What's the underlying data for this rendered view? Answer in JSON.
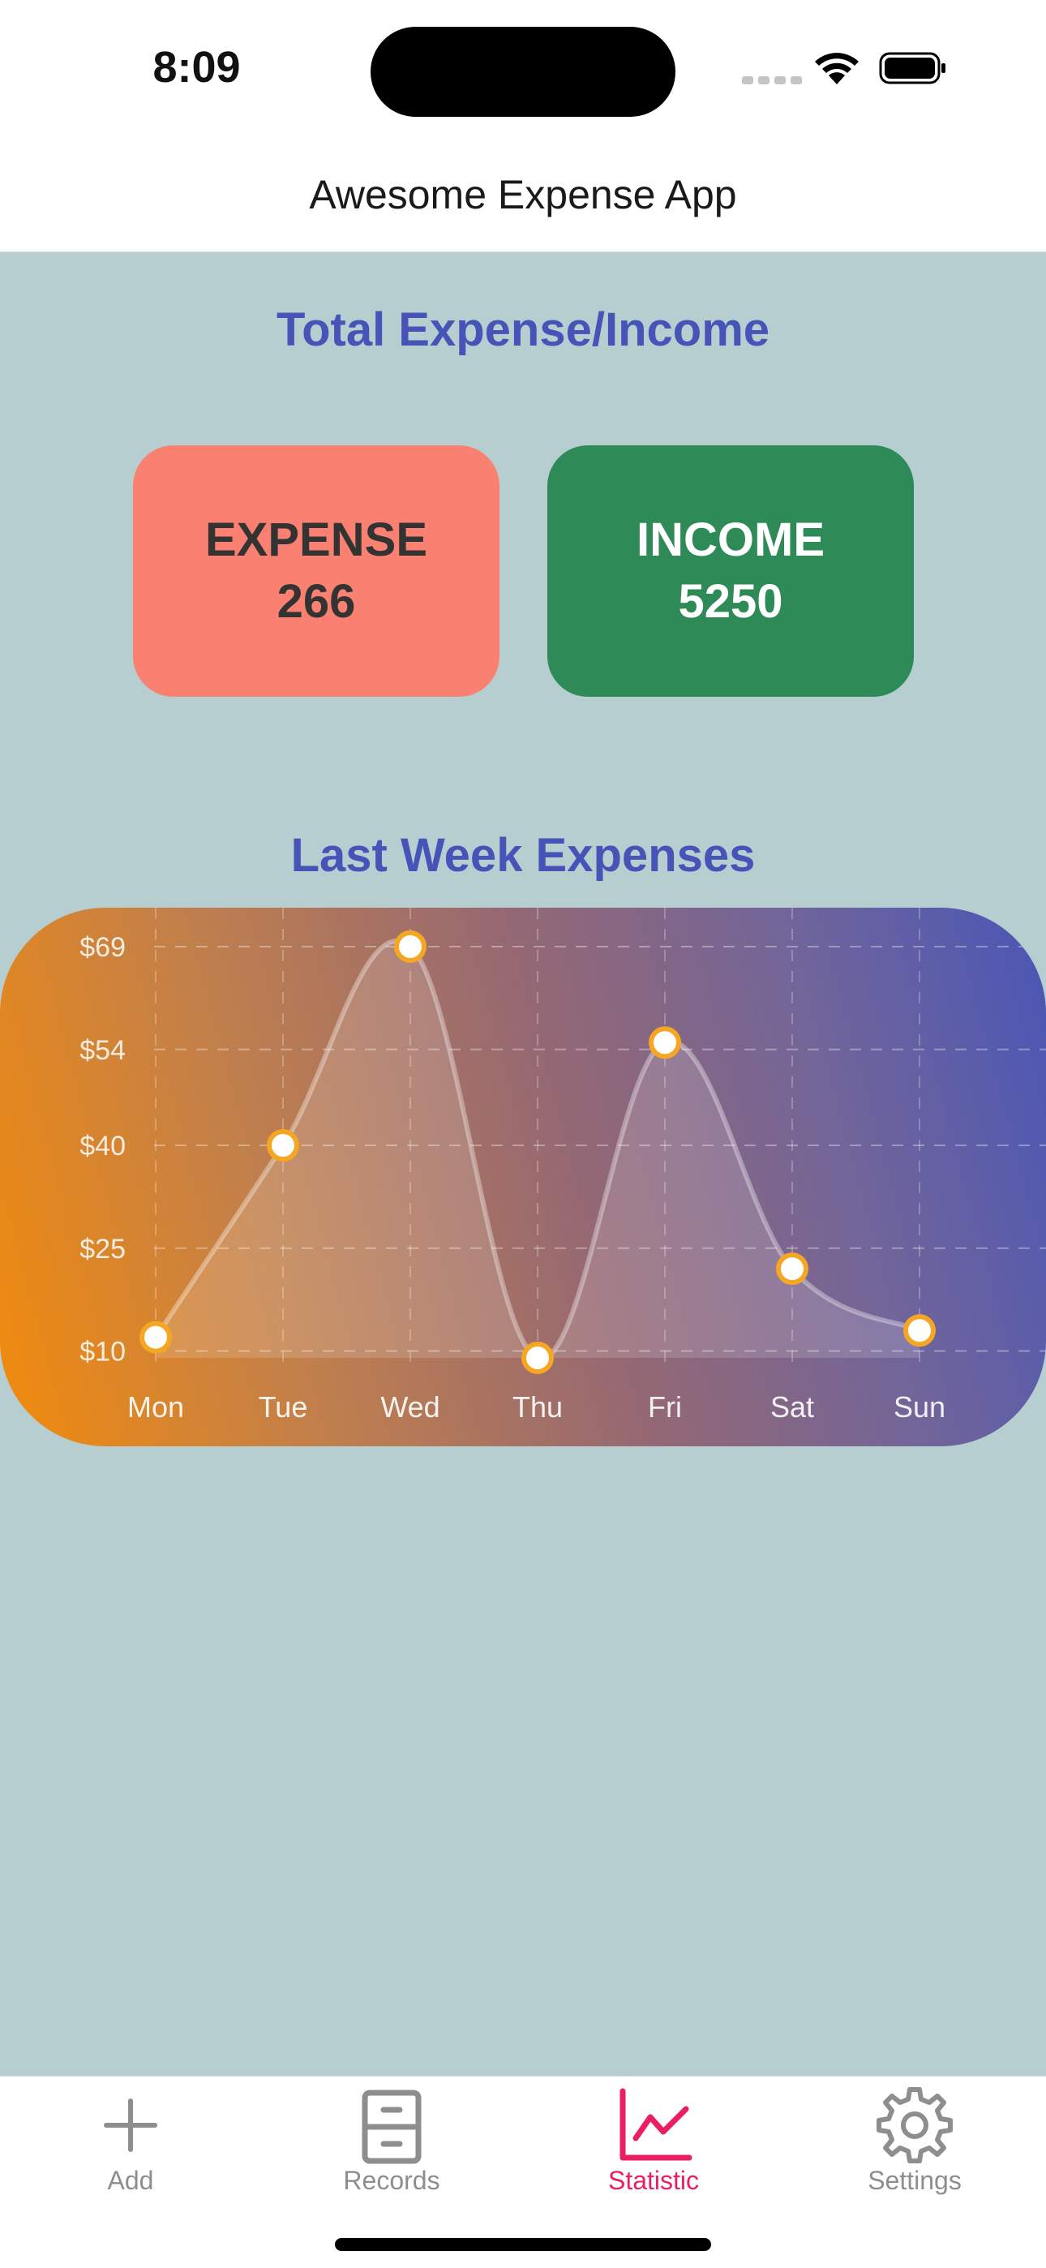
{
  "status_bar": {
    "time": "8:09",
    "icons": [
      "cellular-signal-icon",
      "wifi-icon",
      "battery-icon"
    ]
  },
  "nav": {
    "title": "Awesome Expense App"
  },
  "summary": {
    "title": "Total Expense/Income",
    "expense": {
      "label": "EXPENSE",
      "value": "266",
      "color": "#fa8072"
    },
    "income": {
      "label": "INCOME",
      "value": "5250",
      "color": "#2e8b57"
    }
  },
  "weekly": {
    "title": "Last Week Expenses"
  },
  "chart_data": {
    "type": "line",
    "categories": [
      "Mon",
      "Tue",
      "Wed",
      "Thu",
      "Fri",
      "Sat",
      "Sun"
    ],
    "series": [
      {
        "values": [
          12,
          40,
          69,
          9,
          55,
          22,
          13
        ]
      }
    ],
    "y_ticks": [
      10,
      25,
      40,
      54,
      69
    ],
    "y_tick_labels": [
      "$10",
      "$25",
      "$40",
      "$54",
      "$69"
    ],
    "ylim": [
      9,
      69
    ],
    "grid": true,
    "colors": {
      "line": "#ffffff",
      "point_fill": "#ffffff",
      "point_stroke": "#f5a623"
    }
  },
  "tab_bar": {
    "tabs": [
      {
        "label": "Add",
        "icon": "plus-icon",
        "active": false
      },
      {
        "label": "Records",
        "icon": "cabinet-icon",
        "active": false
      },
      {
        "label": "Statistic",
        "icon": "chart-line-icon",
        "active": true
      },
      {
        "label": "Settings",
        "icon": "gear-icon",
        "active": false
      }
    ],
    "active_color": "#e91e63",
    "inactive_color": "#8e8e8e"
  }
}
